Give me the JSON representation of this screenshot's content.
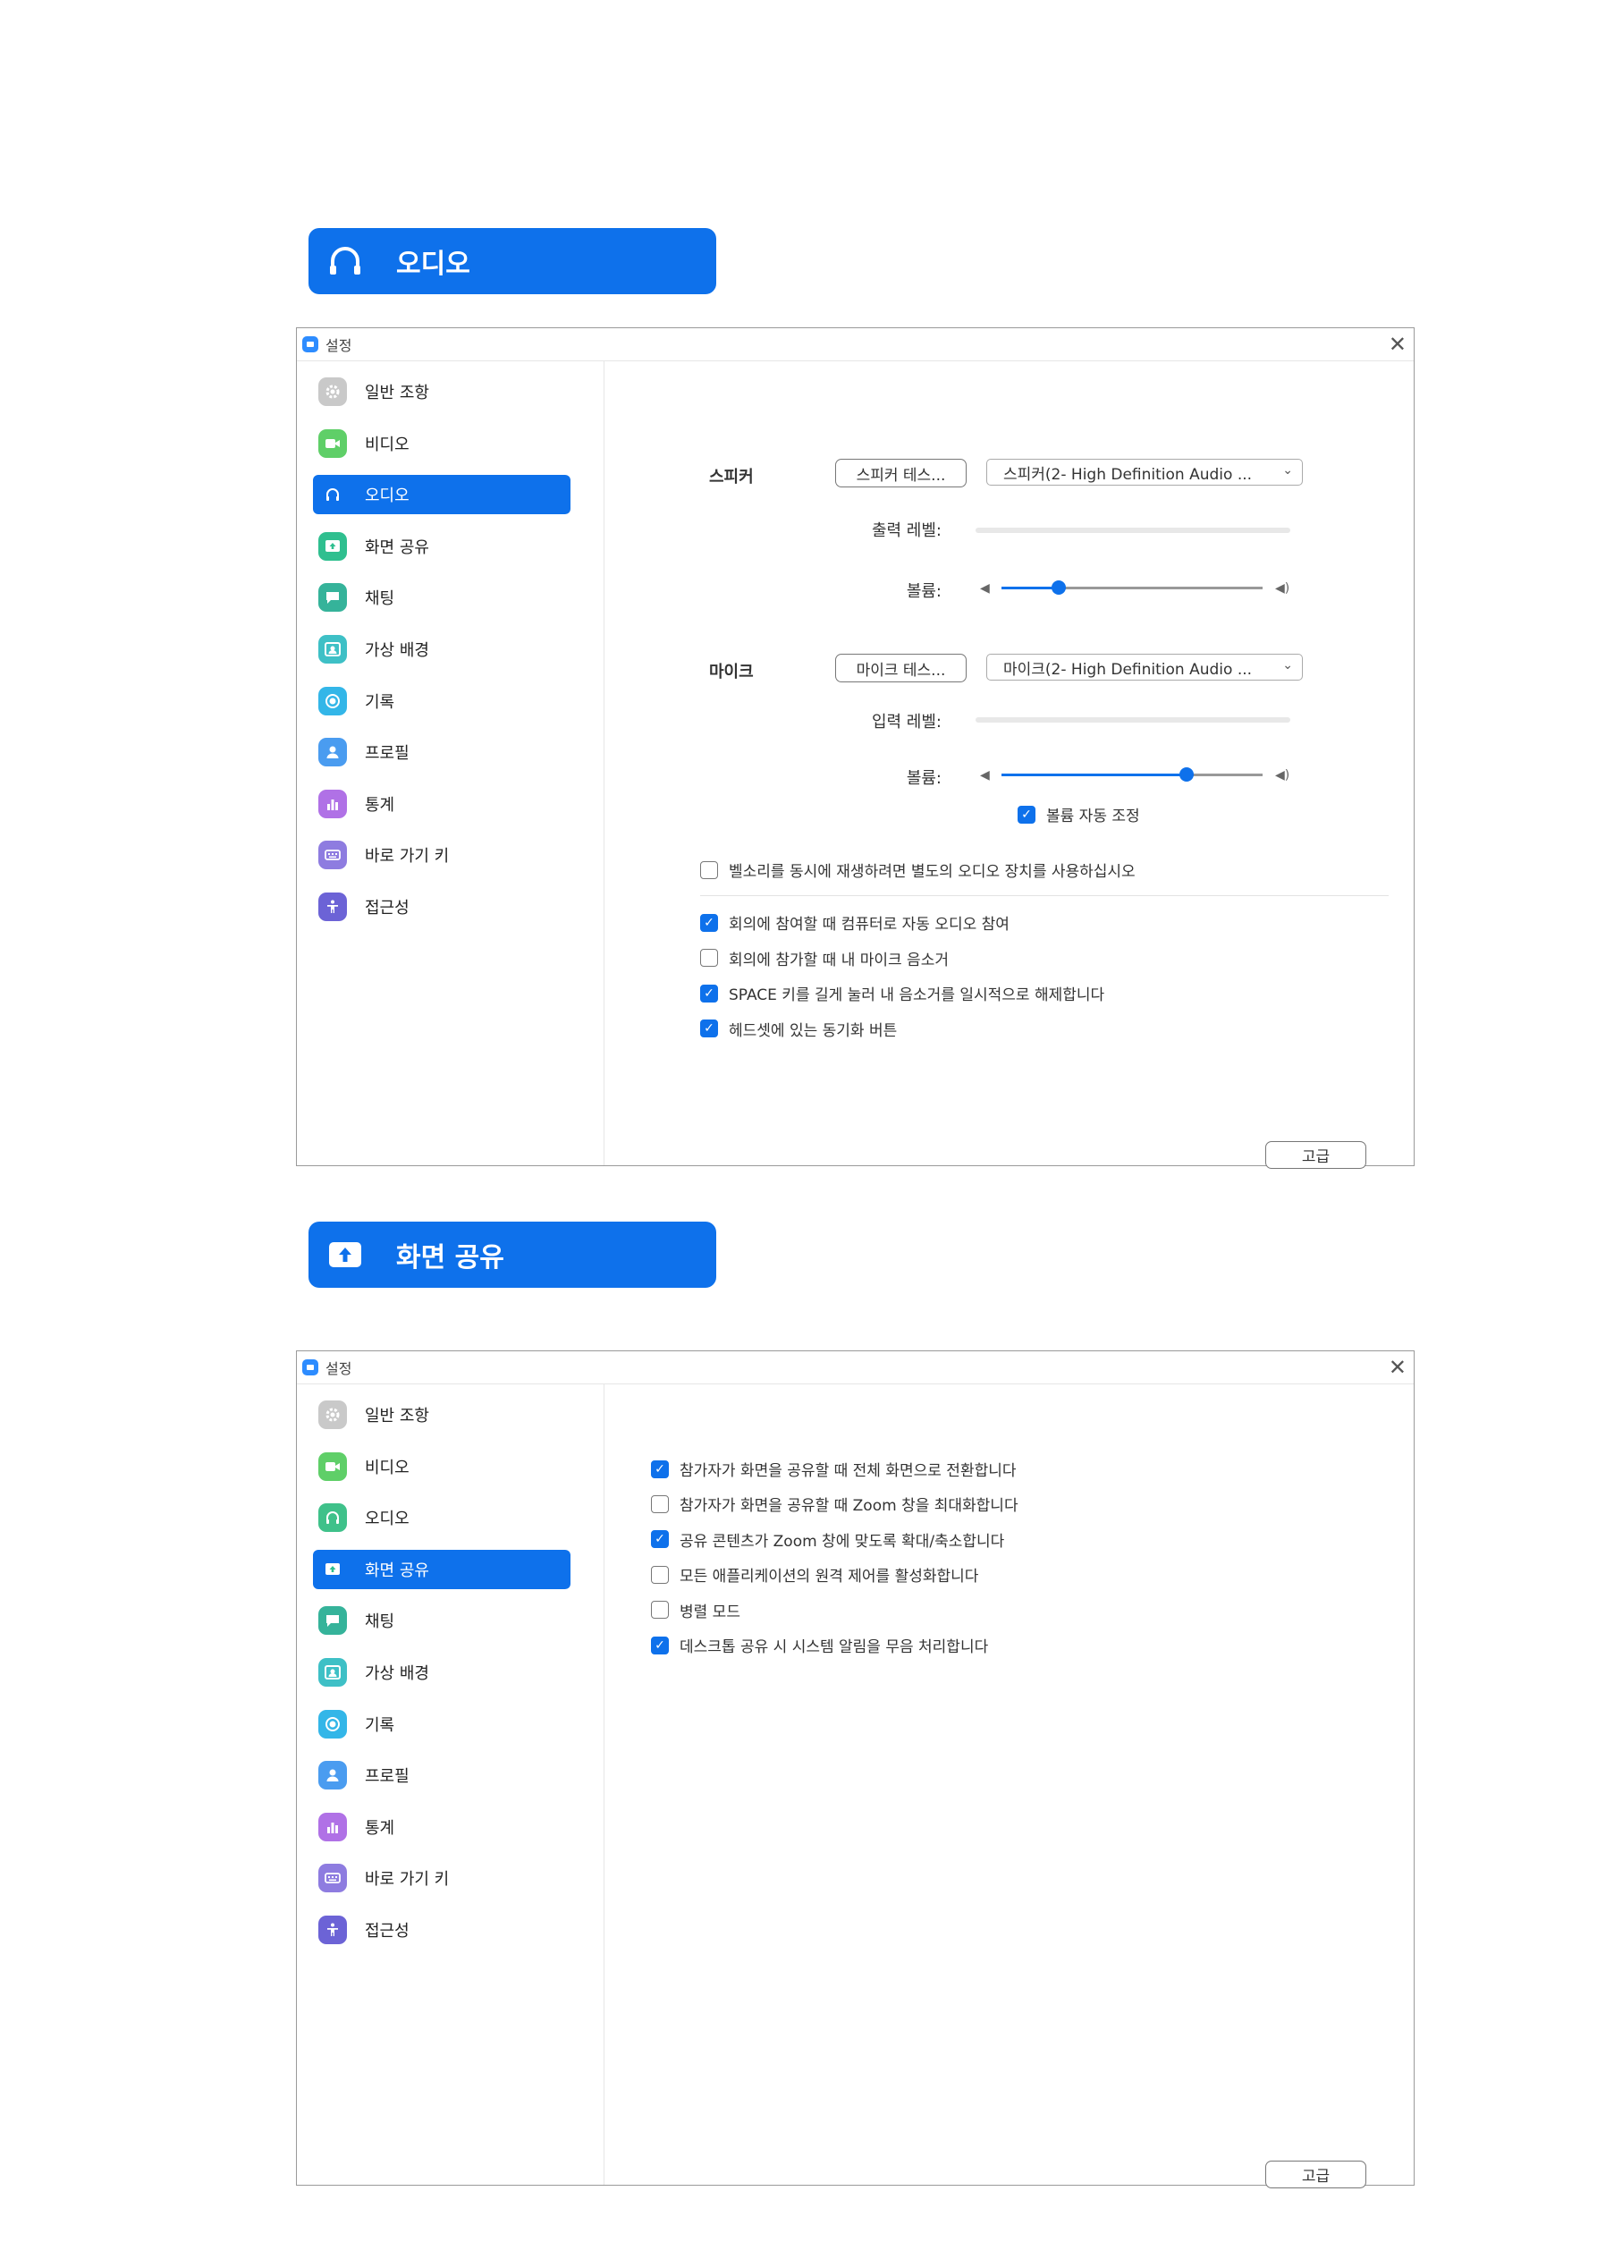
{
  "audio_banner": {
    "label": "오디오",
    "icon": "headphones-icon"
  },
  "share_banner": {
    "label": "화면 공유",
    "icon": "share-screen-icon"
  },
  "window_title": "설정",
  "nav": {
    "items": [
      {
        "label": "일반 조항",
        "icon": "gear-icon",
        "color": "#c9c9c9"
      },
      {
        "label": "비디오",
        "icon": "video-icon",
        "color": "#5fcf68"
      },
      {
        "label": "오디오",
        "icon": "headphones-icon",
        "color": "#3fc18a"
      },
      {
        "label": "화면 공유",
        "icon": "share-screen-icon",
        "color": "#2fbf8f"
      },
      {
        "label": "채팅",
        "icon": "chat-icon",
        "color": "#35b39a"
      },
      {
        "label": "가상 배경",
        "icon": "virtual-background-icon",
        "color": "#3ec0c6"
      },
      {
        "label": "기록",
        "icon": "record-icon",
        "color": "#33b6e8"
      },
      {
        "label": "프로필",
        "icon": "profile-icon",
        "color": "#4a9cf0"
      },
      {
        "label": "통계",
        "icon": "statistics-icon",
        "color": "#b071e6"
      },
      {
        "label": "바로 가기 키",
        "icon": "keyboard-icon",
        "color": "#8e7ce0"
      },
      {
        "label": "접근성",
        "icon": "accessibility-icon",
        "color": "#6c63d6"
      }
    ]
  },
  "audio": {
    "active_nav": "오디오",
    "speaker": {
      "label": "스피커",
      "test_button": "스피커 테스...",
      "device": "스피커(2- High Definition Audio ...",
      "output_level_label": "출력 레벨:",
      "output_level": 0,
      "volume_label": "볼륨:",
      "volume": 0.22
    },
    "mic": {
      "label": "마이크",
      "test_button": "마이크 테스...",
      "device": "마이크(2- High Definition Audio ...",
      "input_level_label": "입력 레벨:",
      "input_level": 0,
      "volume_label": "볼륨:",
      "volume": 0.71,
      "auto_adjust": {
        "label": "볼륨 자동 조정",
        "checked": true
      }
    },
    "ringtone_option": {
      "label": "벨소리를 동시에 재생하려면 별도의 오디오 장치를 사용하십시오",
      "checked": false
    },
    "options": [
      {
        "label": "회의에 참여할 때 컴퓨터로 자동 오디오 참여",
        "checked": true
      },
      {
        "label": "회의에 참가할 때 내 마이크 음소거",
        "checked": false
      },
      {
        "label": "SPACE 키를 길게 눌러 내 음소거를 일시적으로 해제합니다",
        "checked": true
      },
      {
        "label": "헤드셋에 있는 동기화 버튼",
        "checked": true
      }
    ],
    "advanced_button": "고급"
  },
  "share": {
    "active_nav": "화면 공유",
    "options": [
      {
        "label": "참가자가 화면을 공유할 때 전체 화면으로 전환합니다",
        "checked": true
      },
      {
        "label": "참가자가 화면을 공유할 때 Zoom 창을 최대화합니다",
        "checked": false
      },
      {
        "label": "공유 콘텐츠가 Zoom 창에 맞도록 확대/축소합니다",
        "checked": true
      },
      {
        "label": "모든 애플리케이션의 원격 제어를 활성화합니다",
        "checked": false
      },
      {
        "label": "병렬 모드",
        "checked": false
      },
      {
        "label": "데스크톱 공유 시 시스템 알림을 무음 처리합니다",
        "checked": true
      }
    ],
    "advanced_button": "고급"
  },
  "colors": {
    "accent": "#0e71eb"
  }
}
